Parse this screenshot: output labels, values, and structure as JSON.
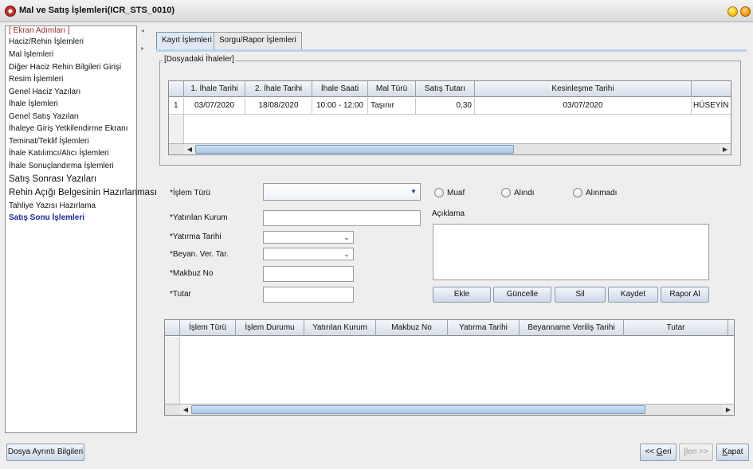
{
  "window": {
    "title": "Mal ve Satış İşlemleri(ICR_STS_0010)"
  },
  "sidebar": {
    "header": "[ Ekran Adımları ]",
    "items": [
      "Haciz/Rehin İşlemleri",
      "Mal İşlemleri",
      "Diğer Haciz Rehin Bilgileri Girişi",
      "Resim İşlemleri",
      "Genel Haciz Yazıları",
      "İhale İşlemleri",
      "Genel Satış Yazıları",
      "İhaleye Giriş Yetkilendirme Ekranı",
      "Teminat/Teklif İşlemleri",
      "İhale Katılımcı/Alıcı İşlemleri",
      "İhale Sonuçlandırma İşlemleri",
      "Satış Sonrası Yazıları",
      "Rehin Açığı Belgesinin Hazırlanması",
      "Tahliye Yazısı Hazırlama",
      "Satış Sonu İşlemleri"
    ]
  },
  "tabs": [
    "Kayıt İşlemleri",
    "Sorgu/Rapor İşlemleri"
  ],
  "ihaleler": {
    "title": "[Dosyadaki İhaleler]",
    "columns": [
      "1. İhale Tarihi",
      "2. İhale Tarihi",
      "İhale Saati",
      "Mal Türü",
      "Satış Tutarı",
      "Kesinleşme Tarihi"
    ],
    "rows": [
      {
        "no": "1",
        "cells": [
          "03/07/2020",
          "18/08/2020",
          "10:00 - 12:00",
          "Taşınır",
          "0,30",
          "03/07/2020",
          "HÜSEYİN C"
        ]
      }
    ]
  },
  "form": {
    "islem_turu": "*İşlem Türü",
    "yatirilan_kurum": "*Yatırılan Kurum",
    "yatirma_tarihi": "*Yatırma Tarihi",
    "beyan_ver_tar": "*Beyan. Ver. Tar.",
    "makbuz_no": "*Makbuz No",
    "tutar": "*Tutar",
    "aciklama": "Açıklama",
    "radios": [
      "Muaf",
      "Alındı",
      "Alınmadı"
    ]
  },
  "actions": [
    "Ekle",
    "Güncelle",
    "Sil",
    "Kaydet",
    "Rapor Al"
  ],
  "islemler": {
    "columns": [
      "İşlem Türü",
      "İşlem Durumu",
      "Yatırılan Kurum",
      "Makbuz No",
      "Yatırma Tarihi",
      "Beyanname Veriliş Tarihi",
      "Tutar"
    ]
  },
  "footer": {
    "dosya_ayrinti": "Dosya Ayrıntı Bilgileri",
    "geri_prefix": "<< ",
    "geri_key": "G",
    "geri_rest": "eri",
    "ileri_key": "İ",
    "ileri_rest": "leri >>",
    "kapat_key": "K",
    "kapat_rest": "apat"
  },
  "icons": {
    "app": "app-logo-icon",
    "minimize": "yellow-circle-icon",
    "close": "orange-circle-icon",
    "combo": "chevron-down-icon",
    "scroll_left": "arrow-left-icon",
    "scroll_right": "arrow-right-icon"
  }
}
